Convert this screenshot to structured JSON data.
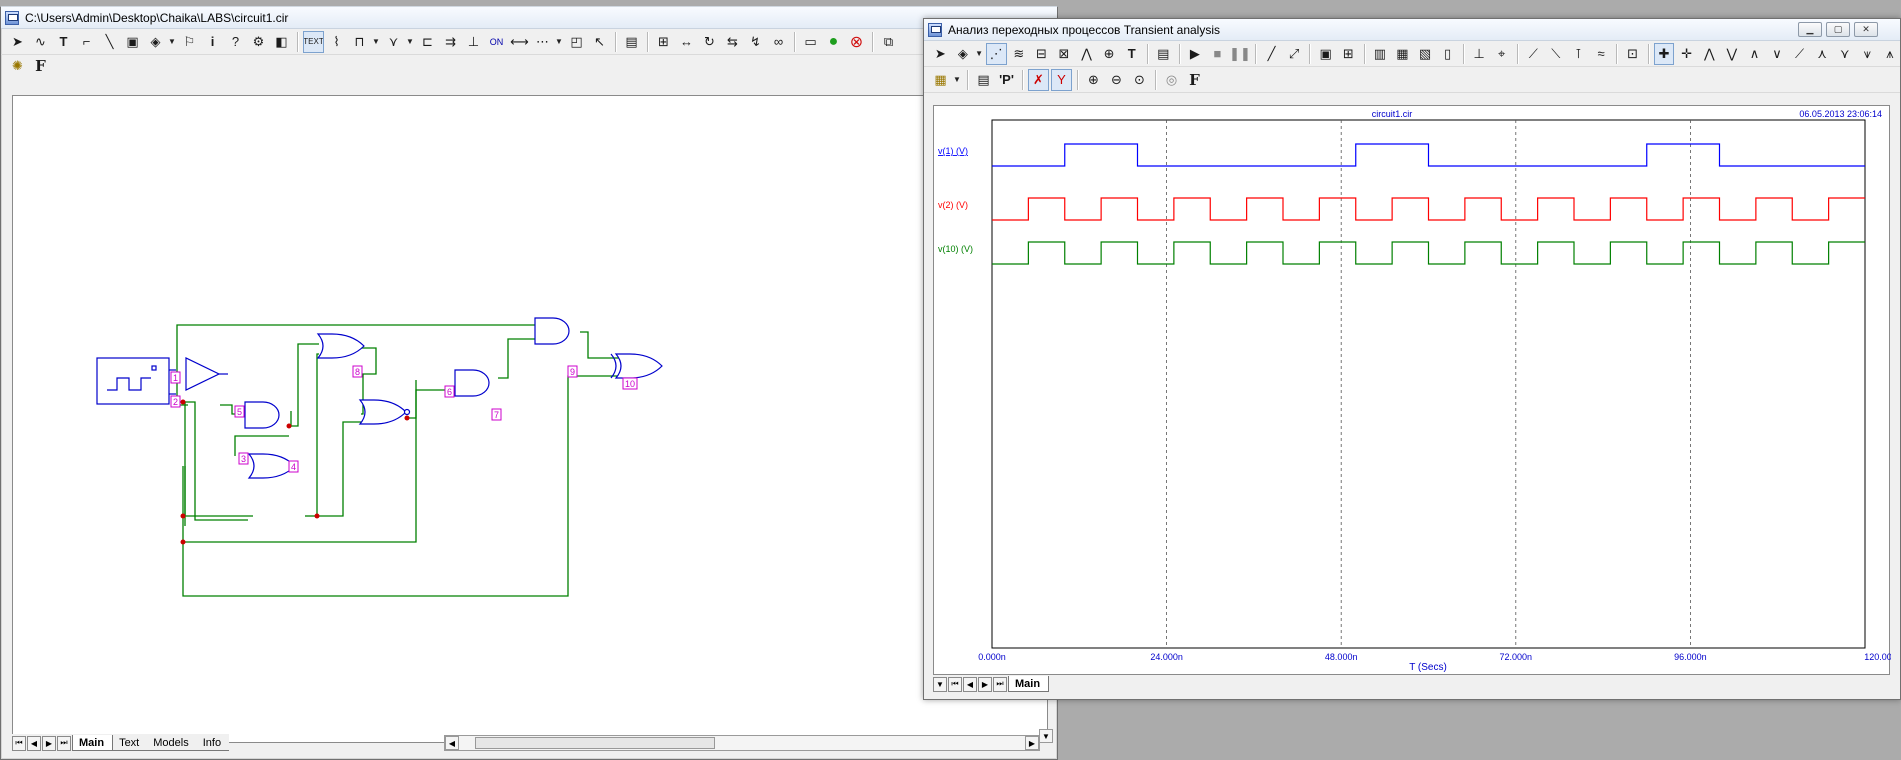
{
  "schematic_window": {
    "title": "C:\\Users\\Admin\\Desktop\\Chaika\\LABS\\circuit1.cir",
    "toolbar_text_button": "TEXT",
    "toolbar_on_button": "ON",
    "toolbar2_font_button": "F",
    "tabs": [
      "Main",
      "Text",
      "Models",
      "Info"
    ],
    "node_labels": [
      "1",
      "2",
      "3",
      "4",
      "5",
      "6",
      "7",
      "8",
      "9",
      "10"
    ],
    "colors": {
      "component": "#0000cc",
      "wire": "#008000",
      "node_label": "#cc00cc",
      "junction": "#cc0000"
    }
  },
  "transient_window": {
    "title": "Анализ переходных процессов Transient analysis",
    "toolbar_text_button": "T",
    "toolbar_p_button": "'P'",
    "toolbar_font_button": "F",
    "tab": "Main",
    "plot_header_file": "circuit1.cir",
    "plot_header_timestamp": "06.05.2013 23:06:14",
    "colors": {
      "v1": "#0000ff",
      "v2": "#ff0000",
      "v10": "#008000",
      "axis_text": "#0000cc"
    }
  },
  "chart_data": {
    "type": "line",
    "title": "circuit1.cir",
    "xlabel": "T (Secs)",
    "x_ticks": [
      "0.000n",
      "24.000n",
      "48.000n",
      "72.000n",
      "96.000n",
      "120.000n"
    ],
    "xlim": [
      0,
      120
    ],
    "x_unit": "ns",
    "grid": "vertical dashed at tick marks",
    "series": [
      {
        "name": "v(1) (V)",
        "color": "#0000ff",
        "period_ns": 40,
        "high_from_ns": 10,
        "high_duration_ns": 10,
        "shape": "square"
      },
      {
        "name": "v(2) (V)",
        "color": "#ff0000",
        "period_ns": 10,
        "high_from_ns": 5,
        "high_duration_ns": 5,
        "shape": "square"
      },
      {
        "name": "v(10) (V)",
        "color": "#008000",
        "period_ns": 10,
        "high_from_ns": 5,
        "high_duration_ns": 5,
        "shape": "square"
      }
    ]
  }
}
